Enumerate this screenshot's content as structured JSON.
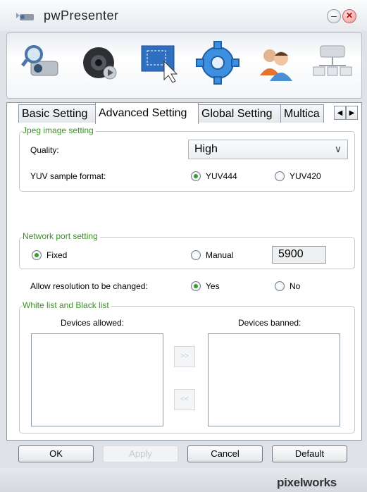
{
  "window": {
    "title": "pwPresenter"
  },
  "toolbar": {
    "icons": [
      "projector-search-icon",
      "webcam-play-icon",
      "screen-capture-icon",
      "gear-icon",
      "users-icon",
      "network-devices-icon"
    ]
  },
  "tabs": [
    "Basic Setting",
    "Advanced Setting",
    "Global Setting",
    "Multica"
  ],
  "active_tab": "Advanced Setting",
  "jpeg": {
    "group_label": "Jpeg image setting",
    "quality_label": "Quality:",
    "quality_value": "High",
    "yuv_label": "YUV sample format:",
    "yuv444": "YUV444",
    "yuv420": "YUV420",
    "selected": "YUV444"
  },
  "network": {
    "group_label": "Network port setting",
    "fixed": "Fixed",
    "manual": "Manual",
    "port": "5900",
    "selected": "Fixed"
  },
  "resolution": {
    "label": "Allow resolution to be changed:",
    "yes": "Yes",
    "no": "No",
    "selected": "Yes"
  },
  "lists": {
    "group_label": "White list and Black list",
    "allowed_label": "Devices allowed:",
    "banned_label": "Devices banned:",
    "to_banned": ">>",
    "to_allowed": "<<"
  },
  "buttons": {
    "ok": "OK",
    "apply": "Apply",
    "cancel": "Cancel",
    "default": "Default"
  },
  "brand": "pixelworks"
}
